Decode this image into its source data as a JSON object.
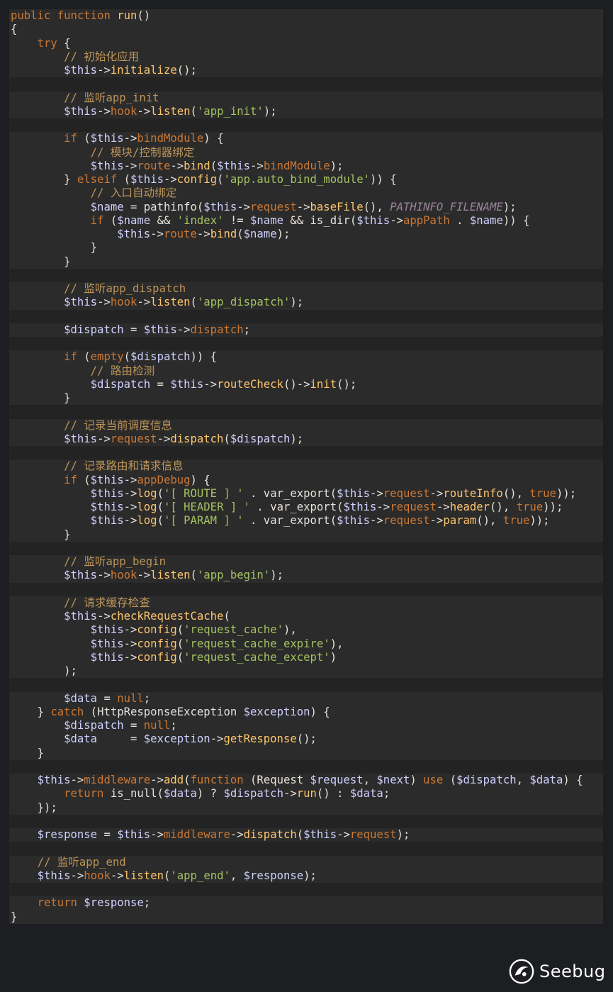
{
  "code_lines": [
    [
      [
        "kw",
        "public"
      ],
      [
        "ws",
        " "
      ],
      [
        "kw",
        "function"
      ],
      [
        "ws",
        " "
      ],
      [
        "fn",
        "run"
      ],
      [
        "plain",
        "()"
      ]
    ],
    [
      [
        "plain",
        "{"
      ]
    ],
    [
      [
        "ws",
        "    "
      ],
      [
        "kw",
        "try"
      ],
      [
        "plain",
        " {"
      ]
    ],
    [
      [
        "ws",
        "        "
      ],
      [
        "cm",
        "// 初始化应用"
      ]
    ],
    [
      [
        "ws",
        "        "
      ],
      [
        "var",
        "$this"
      ],
      [
        "plain",
        "->"
      ],
      [
        "fn",
        "initialize"
      ],
      [
        "plain",
        "();"
      ]
    ],
    [],
    [
      [
        "ws",
        "        "
      ],
      [
        "cm",
        "// 监听app_init"
      ]
    ],
    [
      [
        "ws",
        "        "
      ],
      [
        "var",
        "$this"
      ],
      [
        "plain",
        "->"
      ],
      [
        "kw",
        "hook"
      ],
      [
        "plain",
        "->"
      ],
      [
        "fn",
        "listen"
      ],
      [
        "plain",
        "("
      ],
      [
        "str",
        "'app_init'"
      ],
      [
        "plain",
        ");"
      ]
    ],
    [],
    [
      [
        "ws",
        "        "
      ],
      [
        "kw",
        "if"
      ],
      [
        "plain",
        " ("
      ],
      [
        "var",
        "$this"
      ],
      [
        "plain",
        "->"
      ],
      [
        "kw",
        "bindModule"
      ],
      [
        "plain",
        ") {"
      ]
    ],
    [
      [
        "ws",
        "            "
      ],
      [
        "cm",
        "// 模块/控制器绑定"
      ]
    ],
    [
      [
        "ws",
        "            "
      ],
      [
        "var",
        "$this"
      ],
      [
        "plain",
        "->"
      ],
      [
        "kw",
        "route"
      ],
      [
        "plain",
        "->"
      ],
      [
        "fn",
        "bind"
      ],
      [
        "plain",
        "("
      ],
      [
        "var",
        "$this"
      ],
      [
        "plain",
        "->"
      ],
      [
        "kw",
        "bindModule"
      ],
      [
        "plain",
        ");"
      ]
    ],
    [
      [
        "ws",
        "        "
      ],
      [
        "plain",
        "} "
      ],
      [
        "kw",
        "elseif"
      ],
      [
        "plain",
        " ("
      ],
      [
        "var",
        "$this"
      ],
      [
        "plain",
        "->"
      ],
      [
        "fn",
        "config"
      ],
      [
        "plain",
        "("
      ],
      [
        "str",
        "'app.auto_bind_module'"
      ],
      [
        "plain",
        ")) {"
      ]
    ],
    [
      [
        "ws",
        "            "
      ],
      [
        "cm",
        "// 入口自动绑定"
      ]
    ],
    [
      [
        "ws",
        "            "
      ],
      [
        "var",
        "$name"
      ],
      [
        "plain",
        " = pathinfo("
      ],
      [
        "var",
        "$this"
      ],
      [
        "plain",
        "->"
      ],
      [
        "kw",
        "request"
      ],
      [
        "plain",
        "->"
      ],
      [
        "fn",
        "baseFile"
      ],
      [
        "plain",
        "(), "
      ],
      [
        "const",
        "PATHINFO_FILENAME"
      ],
      [
        "plain",
        ");"
      ]
    ],
    [
      [
        "ws",
        "            "
      ],
      [
        "kw",
        "if"
      ],
      [
        "plain",
        " ("
      ],
      [
        "var",
        "$name"
      ],
      [
        "plain",
        " && "
      ],
      [
        "str",
        "'index'"
      ],
      [
        "plain",
        " != "
      ],
      [
        "var",
        "$name"
      ],
      [
        "plain",
        " && is_dir("
      ],
      [
        "var",
        "$this"
      ],
      [
        "plain",
        "->"
      ],
      [
        "kw",
        "appPath"
      ],
      [
        "plain",
        " . "
      ],
      [
        "var",
        "$name"
      ],
      [
        "plain",
        ")) {"
      ]
    ],
    [
      [
        "ws",
        "                "
      ],
      [
        "var",
        "$this"
      ],
      [
        "plain",
        "->"
      ],
      [
        "kw",
        "route"
      ],
      [
        "plain",
        "->"
      ],
      [
        "fn",
        "bind"
      ],
      [
        "plain",
        "("
      ],
      [
        "var",
        "$name"
      ],
      [
        "plain",
        ");"
      ]
    ],
    [
      [
        "ws",
        "            "
      ],
      [
        "plain",
        "}"
      ]
    ],
    [
      [
        "ws",
        "        "
      ],
      [
        "plain",
        "}"
      ]
    ],
    [],
    [
      [
        "ws",
        "        "
      ],
      [
        "cm",
        "// 监听app_dispatch"
      ]
    ],
    [
      [
        "ws",
        "        "
      ],
      [
        "var",
        "$this"
      ],
      [
        "plain",
        "->"
      ],
      [
        "kw",
        "hook"
      ],
      [
        "plain",
        "->"
      ],
      [
        "fn",
        "listen"
      ],
      [
        "plain",
        "("
      ],
      [
        "str",
        "'app_dispatch'"
      ],
      [
        "plain",
        ");"
      ]
    ],
    [],
    [
      [
        "ws",
        "        "
      ],
      [
        "var",
        "$dispatch"
      ],
      [
        "plain",
        " = "
      ],
      [
        "var",
        "$this"
      ],
      [
        "plain",
        "->"
      ],
      [
        "kw",
        "dispatch"
      ],
      [
        "plain",
        ";"
      ]
    ],
    [],
    [
      [
        "ws",
        "        "
      ],
      [
        "kw",
        "if"
      ],
      [
        "plain",
        " ("
      ],
      [
        "kw",
        "empty"
      ],
      [
        "plain",
        "("
      ],
      [
        "var",
        "$dispatch"
      ],
      [
        "plain",
        ")) {"
      ]
    ],
    [
      [
        "ws",
        "            "
      ],
      [
        "cm",
        "// 路由检测"
      ]
    ],
    [
      [
        "ws",
        "            "
      ],
      [
        "var",
        "$dispatch"
      ],
      [
        "plain",
        " = "
      ],
      [
        "var",
        "$this"
      ],
      [
        "plain",
        "->"
      ],
      [
        "fn",
        "routeCheck"
      ],
      [
        "plain",
        "()->"
      ],
      [
        "fn",
        "init"
      ],
      [
        "plain",
        "();"
      ]
    ],
    [
      [
        "ws",
        "        "
      ],
      [
        "plain",
        "}"
      ]
    ],
    [],
    [
      [
        "ws",
        "        "
      ],
      [
        "cm",
        "// 记录当前调度信息"
      ]
    ],
    [
      [
        "ws",
        "        "
      ],
      [
        "var",
        "$this"
      ],
      [
        "plain",
        "->"
      ],
      [
        "kw",
        "request"
      ],
      [
        "plain",
        "->"
      ],
      [
        "fn",
        "dispatch"
      ],
      [
        "plain",
        "("
      ],
      [
        "var",
        "$dispatch"
      ],
      [
        "plain",
        ");"
      ]
    ],
    [],
    [
      [
        "ws",
        "        "
      ],
      [
        "cm",
        "// 记录路由和请求信息"
      ]
    ],
    [
      [
        "ws",
        "        "
      ],
      [
        "kw",
        "if"
      ],
      [
        "plain",
        " ("
      ],
      [
        "var",
        "$this"
      ],
      [
        "plain",
        "->"
      ],
      [
        "kw",
        "appDebug"
      ],
      [
        "plain",
        ") {"
      ]
    ],
    [
      [
        "ws",
        "            "
      ],
      [
        "var",
        "$this"
      ],
      [
        "plain",
        "->"
      ],
      [
        "fn",
        "log"
      ],
      [
        "plain",
        "("
      ],
      [
        "str",
        "'[ ROUTE ] '"
      ],
      [
        "plain",
        " . var_export("
      ],
      [
        "var",
        "$this"
      ],
      [
        "plain",
        "->"
      ],
      [
        "kw",
        "request"
      ],
      [
        "plain",
        "->"
      ],
      [
        "fn",
        "routeInfo"
      ],
      [
        "plain",
        "(), "
      ],
      [
        "kw",
        "true"
      ],
      [
        "plain",
        "));"
      ]
    ],
    [
      [
        "ws",
        "            "
      ],
      [
        "var",
        "$this"
      ],
      [
        "plain",
        "->"
      ],
      [
        "fn",
        "log"
      ],
      [
        "plain",
        "("
      ],
      [
        "str",
        "'[ HEADER ] '"
      ],
      [
        "plain",
        " . var_export("
      ],
      [
        "var",
        "$this"
      ],
      [
        "plain",
        "->"
      ],
      [
        "kw",
        "request"
      ],
      [
        "plain",
        "->"
      ],
      [
        "fn",
        "header"
      ],
      [
        "plain",
        "(), "
      ],
      [
        "kw",
        "true"
      ],
      [
        "plain",
        "));"
      ]
    ],
    [
      [
        "ws",
        "            "
      ],
      [
        "var",
        "$this"
      ],
      [
        "plain",
        "->"
      ],
      [
        "fn",
        "log"
      ],
      [
        "plain",
        "("
      ],
      [
        "str",
        "'[ PARAM ] '"
      ],
      [
        "plain",
        " . var_export("
      ],
      [
        "var",
        "$this"
      ],
      [
        "plain",
        "->"
      ],
      [
        "kw",
        "request"
      ],
      [
        "plain",
        "->"
      ],
      [
        "fn",
        "param"
      ],
      [
        "plain",
        "(), "
      ],
      [
        "kw",
        "true"
      ],
      [
        "plain",
        "));"
      ]
    ],
    [
      [
        "ws",
        "        "
      ],
      [
        "plain",
        "}"
      ]
    ],
    [],
    [
      [
        "ws",
        "        "
      ],
      [
        "cm",
        "// 监听app_begin"
      ]
    ],
    [
      [
        "ws",
        "        "
      ],
      [
        "var",
        "$this"
      ],
      [
        "plain",
        "->"
      ],
      [
        "kw",
        "hook"
      ],
      [
        "plain",
        "->"
      ],
      [
        "fn",
        "listen"
      ],
      [
        "plain",
        "("
      ],
      [
        "str",
        "'app_begin'"
      ],
      [
        "plain",
        ");"
      ]
    ],
    [],
    [
      [
        "ws",
        "        "
      ],
      [
        "cm",
        "// 请求缓存检查"
      ]
    ],
    [
      [
        "ws",
        "        "
      ],
      [
        "var",
        "$this"
      ],
      [
        "plain",
        "->"
      ],
      [
        "fn",
        "checkRequestCache"
      ],
      [
        "plain",
        "("
      ]
    ],
    [
      [
        "ws",
        "            "
      ],
      [
        "var",
        "$this"
      ],
      [
        "plain",
        "->"
      ],
      [
        "fn",
        "config"
      ],
      [
        "plain",
        "("
      ],
      [
        "str",
        "'request_cache'"
      ],
      [
        "plain",
        "),"
      ]
    ],
    [
      [
        "ws",
        "            "
      ],
      [
        "var",
        "$this"
      ],
      [
        "plain",
        "->"
      ],
      [
        "fn",
        "config"
      ],
      [
        "plain",
        "("
      ],
      [
        "str",
        "'request_cache_expire'"
      ],
      [
        "plain",
        "),"
      ]
    ],
    [
      [
        "ws",
        "            "
      ],
      [
        "var",
        "$this"
      ],
      [
        "plain",
        "->"
      ],
      [
        "fn",
        "config"
      ],
      [
        "plain",
        "("
      ],
      [
        "str",
        "'request_cache_except'"
      ],
      [
        "plain",
        ")"
      ]
    ],
    [
      [
        "ws",
        "        "
      ],
      [
        "plain",
        ");"
      ]
    ],
    [],
    [
      [
        "ws",
        "        "
      ],
      [
        "var",
        "$data"
      ],
      [
        "plain",
        " = "
      ],
      [
        "kw",
        "null"
      ],
      [
        "plain",
        ";"
      ]
    ],
    [
      [
        "ws",
        "    "
      ],
      [
        "plain",
        "} "
      ],
      [
        "kw",
        "catch"
      ],
      [
        "plain",
        " (HttpResponseException "
      ],
      [
        "var",
        "$exception"
      ],
      [
        "plain",
        ") {"
      ]
    ],
    [
      [
        "ws",
        "        "
      ],
      [
        "var",
        "$dispatch"
      ],
      [
        "plain",
        " = "
      ],
      [
        "kw",
        "null"
      ],
      [
        "plain",
        ";"
      ]
    ],
    [
      [
        "ws",
        "        "
      ],
      [
        "var",
        "$data"
      ],
      [
        "plain",
        "     = "
      ],
      [
        "var",
        "$exception"
      ],
      [
        "plain",
        "->"
      ],
      [
        "fn",
        "getResponse"
      ],
      [
        "plain",
        "();"
      ]
    ],
    [
      [
        "ws",
        "    "
      ],
      [
        "plain",
        "}"
      ]
    ],
    [],
    [
      [
        "ws",
        "    "
      ],
      [
        "var",
        "$this"
      ],
      [
        "plain",
        "->"
      ],
      [
        "kw",
        "middleware"
      ],
      [
        "plain",
        "->"
      ],
      [
        "fn",
        "add"
      ],
      [
        "plain",
        "("
      ],
      [
        "kw",
        "function"
      ],
      [
        "plain",
        " (Request "
      ],
      [
        "var",
        "$request"
      ],
      [
        "plain",
        ", "
      ],
      [
        "var",
        "$next"
      ],
      [
        "plain",
        ") "
      ],
      [
        "kw",
        "use"
      ],
      [
        "plain",
        " ("
      ],
      [
        "var",
        "$dispatch"
      ],
      [
        "plain",
        ", "
      ],
      [
        "var",
        "$data"
      ],
      [
        "plain",
        ") {"
      ]
    ],
    [
      [
        "ws",
        "        "
      ],
      [
        "kw",
        "return"
      ],
      [
        "plain",
        " is_null("
      ],
      [
        "var",
        "$data"
      ],
      [
        "plain",
        ") ? "
      ],
      [
        "var",
        "$dispatch"
      ],
      [
        "plain",
        "->"
      ],
      [
        "fn",
        "run"
      ],
      [
        "plain",
        "() : "
      ],
      [
        "var",
        "$data"
      ],
      [
        "plain",
        ";"
      ]
    ],
    [
      [
        "ws",
        "    "
      ],
      [
        "plain",
        "});"
      ]
    ],
    [],
    [
      [
        "ws",
        "    "
      ],
      [
        "var",
        "$response"
      ],
      [
        "plain",
        " = "
      ],
      [
        "var",
        "$this"
      ],
      [
        "plain",
        "->"
      ],
      [
        "kw",
        "middleware"
      ],
      [
        "plain",
        "->"
      ],
      [
        "fn",
        "dispatch"
      ],
      [
        "plain",
        "("
      ],
      [
        "var",
        "$this"
      ],
      [
        "plain",
        "->"
      ],
      [
        "kw",
        "request"
      ],
      [
        "plain",
        ");"
      ]
    ],
    [],
    [
      [
        "ws",
        "    "
      ],
      [
        "cm",
        "// 监听app_end"
      ]
    ],
    [
      [
        "ws",
        "    "
      ],
      [
        "var",
        "$this"
      ],
      [
        "plain",
        "->"
      ],
      [
        "kw",
        "hook"
      ],
      [
        "plain",
        "->"
      ],
      [
        "fn",
        "listen"
      ],
      [
        "plain",
        "("
      ],
      [
        "str",
        "'app_end'"
      ],
      [
        "plain",
        ", "
      ],
      [
        "var",
        "$response"
      ],
      [
        "plain",
        ");"
      ]
    ],
    [],
    [
      [
        "ws",
        "    "
      ],
      [
        "kw",
        "return"
      ],
      [
        "plain",
        " "
      ],
      [
        "var",
        "$response"
      ],
      [
        "plain",
        ";"
      ]
    ],
    [
      [
        "plain",
        "}"
      ]
    ]
  ],
  "watermark": {
    "text": "Seebug",
    "icon": "seebug-logo-icon"
  },
  "colors": {
    "background": "#2b2b2b",
    "keyword": "#cc7833",
    "function": "#ffc66d",
    "variable": "#d0d0ff",
    "string": "#a5c261",
    "comment": "#bc9458"
  }
}
